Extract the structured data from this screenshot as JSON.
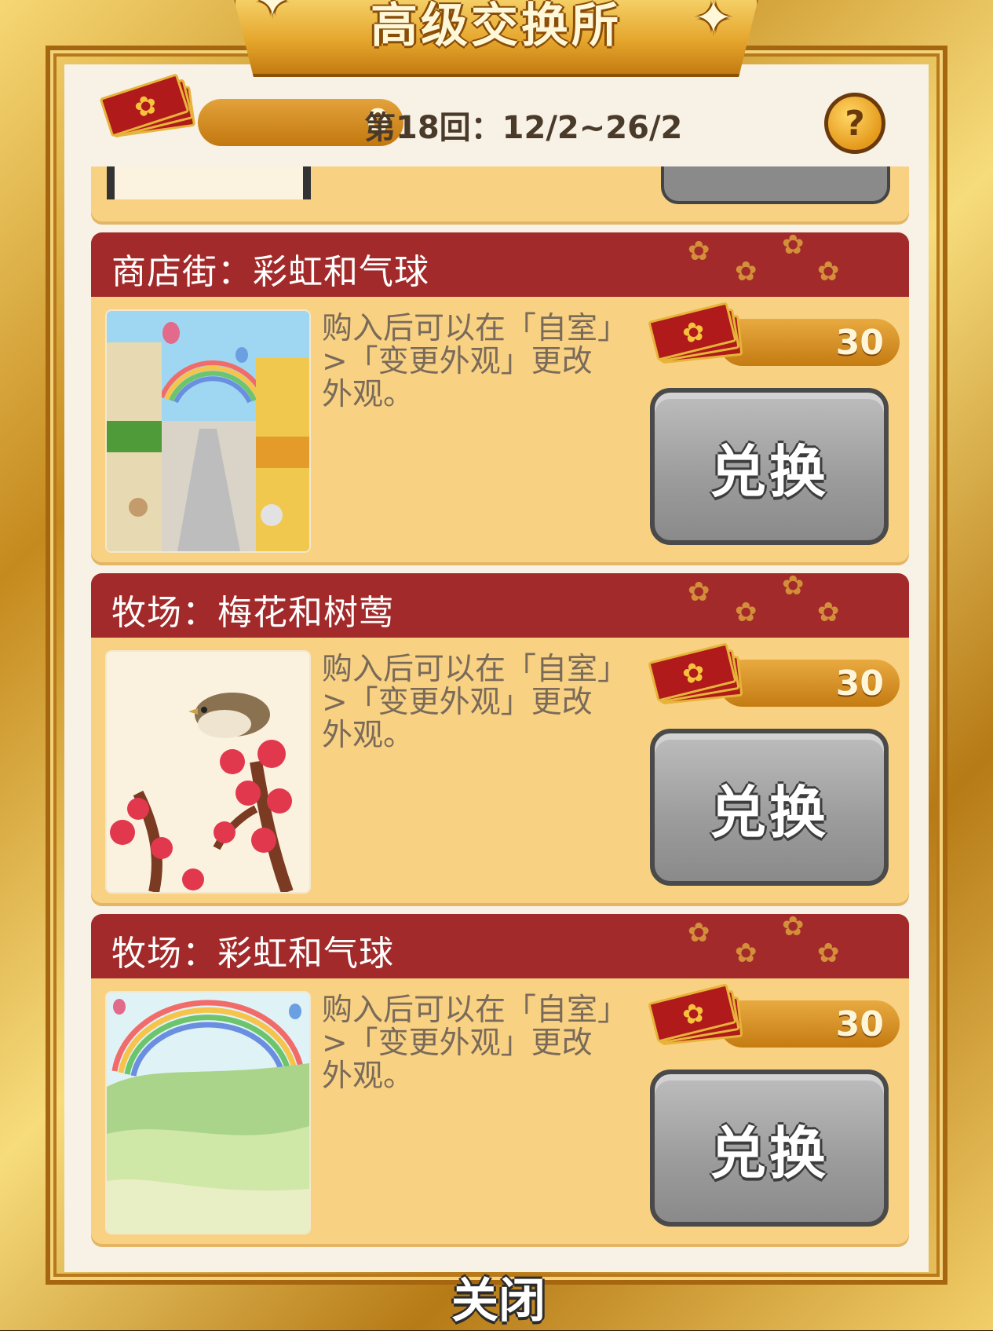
{
  "dialog": {
    "title": "高级交换所",
    "balance": "0",
    "round_text": "第18回：12/2~26/2",
    "help_glyph": "?",
    "close_label": "关闭"
  },
  "items": [
    {
      "title": "商店街：彩虹和气球",
      "description": "购入后可以在「自室」>「变更外观」更改外观。",
      "price": "30",
      "button_label": "兑换",
      "thumb_icon": "shopping-street-rainbow-balloons-image"
    },
    {
      "title": "牧场：梅花和树莺",
      "description": "购入后可以在「自室」>「变更外观」更改外观。",
      "price": "30",
      "button_label": "兑换",
      "thumb_icon": "plum-blossom-warbler-image"
    },
    {
      "title": "牧场：彩虹和气球",
      "description": "购入后可以在「自室」>「变更外观」更改外观。",
      "price": "30",
      "button_label": "兑换",
      "thumb_icon": "meadow-rainbow-balloons-image"
    }
  ],
  "colors": {
    "header_red": "#a32a2a",
    "card_bg": "#f8d282",
    "gold": "#e5a52c",
    "button_gray": "#9b9b9b"
  }
}
